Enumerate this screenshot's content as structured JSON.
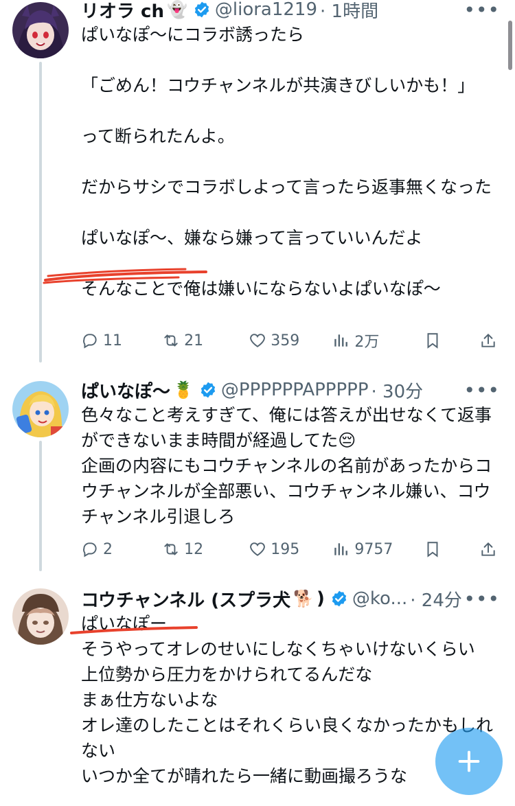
{
  "colors": {
    "accent": "#1d9bf0",
    "muted": "#536471",
    "line": "#cfd9de",
    "annotation": "#e8412c"
  },
  "tweets": [
    {
      "name": "リオラ ch",
      "emoji": "👻",
      "handle": "@liora1219",
      "time": "· 1時間",
      "text": "ぱいなぽ〜にコラボ誘ったら\n\n「ごめん！コウチャンネルが共演きびしいかも！」\n\nって断られたんよ。\n\nだからサシでコラボしよって言ったら返事無くなった\n\nぱいなぽ〜、嫌なら嫌って言っていいんだよ\n\nそんなことで俺は嫌いにならないよぱいなぽ〜",
      "replies": "11",
      "retweets": "21",
      "likes": "359",
      "views": "2万"
    },
    {
      "name": "ぱいなぽ〜",
      "emoji": "🍍",
      "handle": "@PPPPPPAPPPPP",
      "time": "· 30分",
      "text": "色々なこと考えすぎて、俺には答えが出せなくて返事ができないまま時間が経過してた😔\n企画の内容にもコウチャンネルの名前があったからコウチャンネルが全部悪い、コウチャンネル嫌い、コウチャンネル引退しろ",
      "replies": "2",
      "retweets": "12",
      "likes": "195",
      "views": "9757"
    },
    {
      "name": "コウチャンネル (スプラ犬",
      "emoji": "🐕",
      "name_suffix": ")",
      "handle": "@ko...",
      "time": "· 24分",
      "text": "ぱいなぽー\nそうやってオレのせいにしなくちゃいけないくらい\n上位勢から圧力をかけられてるんだな\nまぁ仕方ないよな\nオレ達のしたことはそれくらい良くなかったかもしれない\nいつか全てが晴れたら一緒に動画撮ろうな"
    }
  ],
  "icons": {
    "more": "more-dots-icon",
    "reply": "reply-bubble-icon",
    "retweet": "retweet-arrows-icon",
    "like": "heart-icon",
    "views": "bar-chart-icon",
    "bookmark": "bookmark-icon",
    "share": "share-upload-icon",
    "compose": "plus-icon"
  }
}
